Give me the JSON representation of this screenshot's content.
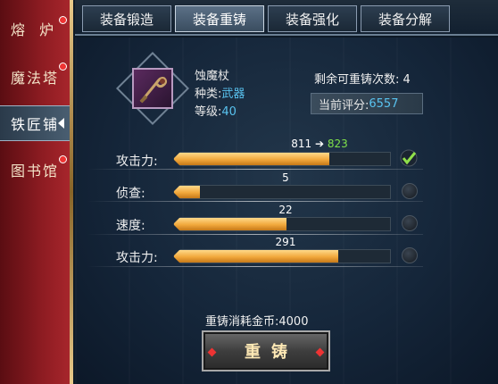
{
  "sidebar": {
    "items": [
      {
        "label": "熔  炉",
        "badge": true
      },
      {
        "label": "魔法塔",
        "badge": true
      },
      {
        "label": "铁匠铺",
        "badge": false
      },
      {
        "label": "图书馆",
        "badge": true
      }
    ],
    "active_index": 2
  },
  "tabs": [
    {
      "label": "装备锻造"
    },
    {
      "label": "装备重铸"
    },
    {
      "label": "装备强化"
    },
    {
      "label": "装备分解"
    }
  ],
  "active_tab": 1,
  "item": {
    "name": "蚀魔杖",
    "type_label": "种类:",
    "type_value": "武器",
    "level_label": "等级:",
    "level_value": "40"
  },
  "remaining": {
    "label": "剩余可重铸次数:",
    "value": "4"
  },
  "score": {
    "label": "当前评分:",
    "value": "6557"
  },
  "stats": [
    {
      "label": "攻击力:",
      "value": "811",
      "new_value": "823",
      "fill_pct": 72,
      "selected": true
    },
    {
      "label": "侦查:",
      "value": "5",
      "new_value": "",
      "fill_pct": 12,
      "selected": false
    },
    {
      "label": "速度:",
      "value": "22",
      "new_value": "",
      "fill_pct": 52,
      "selected": false
    },
    {
      "label": "攻击力:",
      "value": "291",
      "new_value": "",
      "fill_pct": 76,
      "selected": false
    }
  ],
  "arrow_symbol": "➔",
  "cost": {
    "label": "重铸消耗金币:",
    "value": "4000"
  },
  "recast_button": "重铸",
  "colors": {
    "accent_blue": "#59c3f0",
    "bar_gold": "#f1a83c",
    "new_value_green": "#7ee04a",
    "sidebar_red": "#8e1c22"
  }
}
